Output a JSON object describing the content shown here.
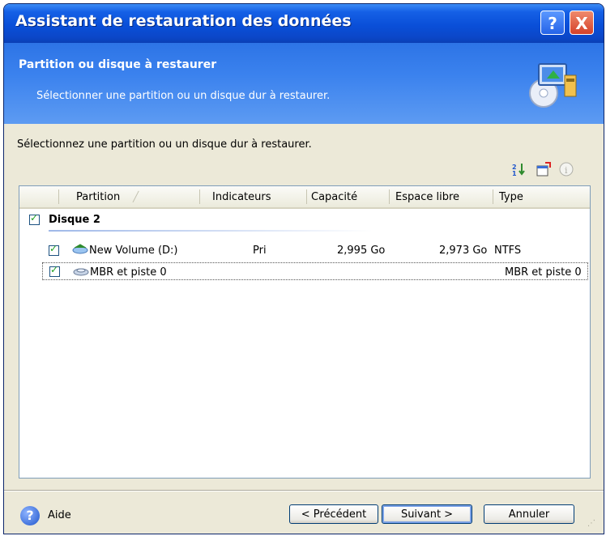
{
  "window": {
    "title": "Assistant de restauration des données",
    "help_button": "?",
    "close_button": "X"
  },
  "header": {
    "title": "Partition ou disque à restaurer",
    "subtitle": "Sélectionner une partition ou un disque dur à restaurer."
  },
  "content": {
    "instruction": "Sélectionnez une partition ou un disque dur à restaurer.",
    "toolbar_icons": [
      "sort-icon",
      "properties-icon",
      "info-icon"
    ]
  },
  "list": {
    "columns": [
      "Partition",
      "Indicateurs",
      "Capacité",
      "Espace libre",
      "Type"
    ],
    "group": {
      "label": "Disque 2",
      "checked": true
    },
    "rows": [
      {
        "checked": true,
        "name": "New Volume (D:)",
        "flags": "Pri",
        "capacity": "2,995 Go",
        "free": "2,973 Go",
        "type": "NTFS",
        "icon": "volume-icon"
      },
      {
        "checked": true,
        "name": "MBR et piste 0",
        "flags": "",
        "capacity": "",
        "free": "",
        "type": "MBR et piste 0",
        "icon": "mbr-icon"
      }
    ]
  },
  "footer": {
    "help_label": "Aide",
    "back_label": "< Précédent",
    "next_label": "Suivant >",
    "cancel_label": "Annuler"
  },
  "colors": {
    "titlebar": "#0a4fd8",
    "header": "#3b82ee",
    "dialog_bg": "#ece9d8",
    "check": "#21a121"
  }
}
